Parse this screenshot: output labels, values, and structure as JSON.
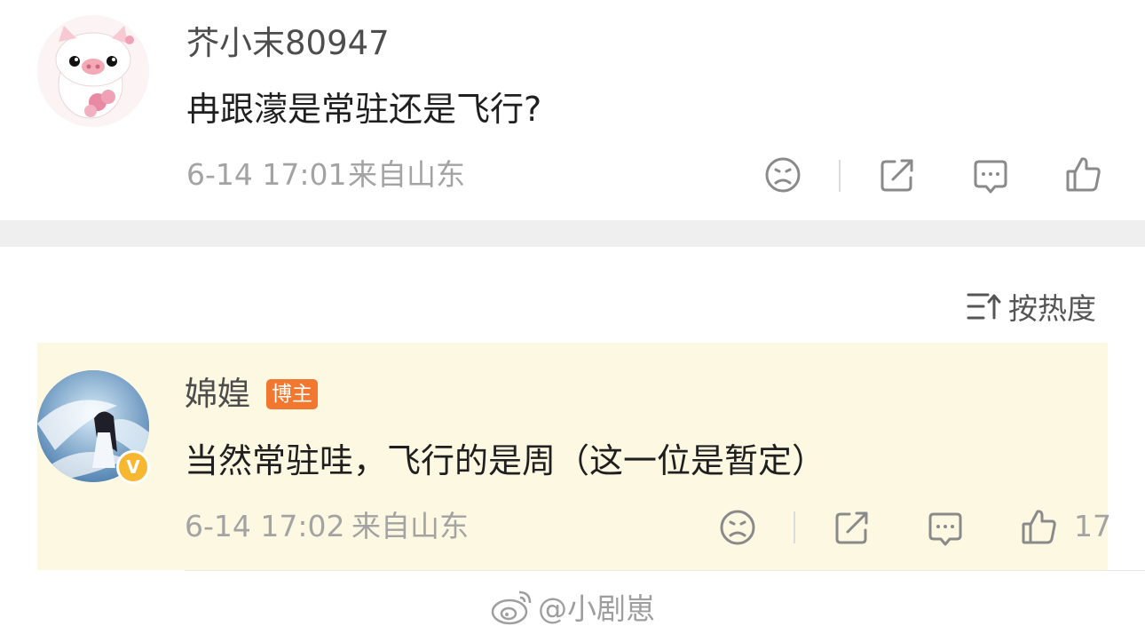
{
  "comment1": {
    "username": "芥小末80947",
    "text": "冉跟濛是常驻还是飞行?",
    "time": "6-14 17:01",
    "location": "来自山东",
    "avatar_icon": "pig-cartoon-avatar"
  },
  "sort": {
    "label": "按热度",
    "icon": "sort-icon"
  },
  "comment2": {
    "username": "婂媓",
    "badge": "博主",
    "verified_mark": "V",
    "text": "当然常驻哇，飞行的是周（这一位是暂定）",
    "time": "6-14 17:02",
    "location": "来自山东",
    "like_count": "17",
    "highlight_color": "#fdf8e2"
  },
  "watermark": {
    "text": "@小剧崽",
    "icon": "weibo-icon"
  },
  "colors": {
    "badge": "#f2782f",
    "verified": "#f7b731",
    "meta_text": "#a3a3a3"
  }
}
